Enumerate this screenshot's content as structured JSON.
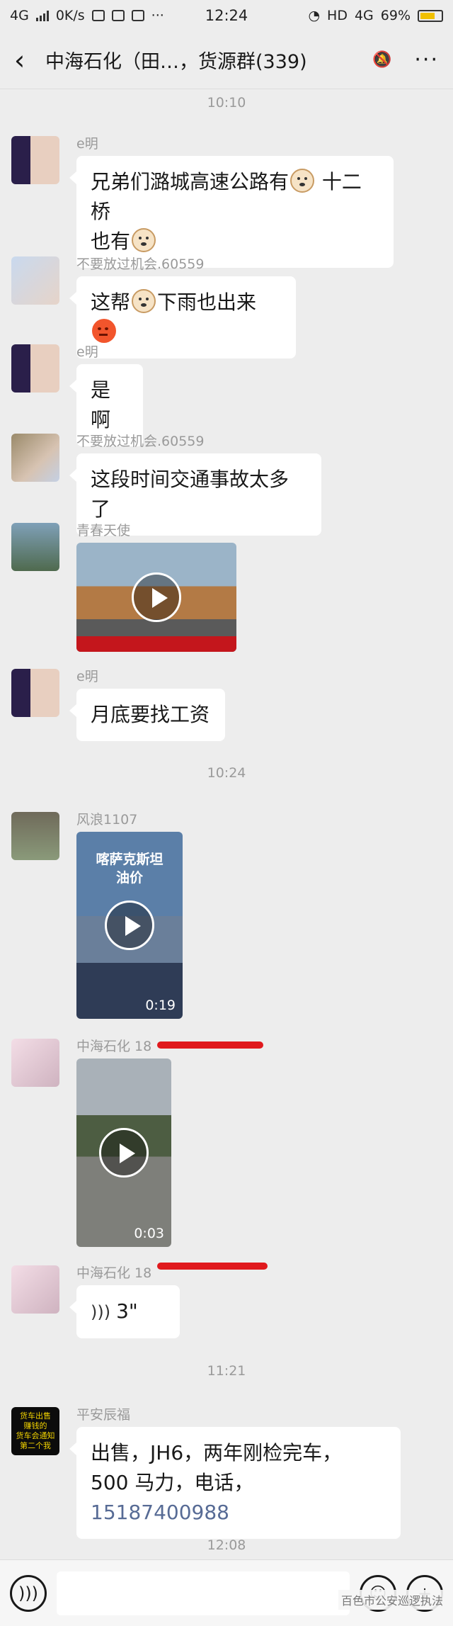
{
  "status_bar": {
    "network": "4G",
    "speed": "0K/s",
    "time": "12:24",
    "right_text": "HD",
    "network_right": "4G",
    "battery": "69%"
  },
  "header": {
    "back_icon": "chevron-left-icon",
    "title": "中海石化（田…，货源群(339)",
    "mute_icon": "bell-off-icon",
    "more_icon": "more-dots-icon"
  },
  "messages": {
    "time_1": "10:10",
    "m1_sender": "e明",
    "m1_text_a": "兄弟们潞城高速公路有",
    "m1_text_b": " 十二桥",
    "m1_text_c": "也有",
    "m2_sender": "不要放过机会.60559",
    "m2_text_a": "这帮",
    "m2_text_b": "下雨也出来",
    "m3_sender": "e明",
    "m3_text": "是啊",
    "m4_sender": "不要放过机会.60559",
    "m4_text": "这段时间交通事故太多了",
    "m5_sender": "青春天使",
    "m6_sender": "e明",
    "m6_text": "月底要找工资",
    "time_2": "10:24",
    "m7_sender": "风浪1107",
    "m7_video_caption": "喀萨克斯坦\n油价",
    "m7_duration": "0:19",
    "m8_sender": "中海石化 18",
    "m8_duration": "0:03",
    "m9_sender": "中海石化 18",
    "m9_voice_length": "3\"",
    "time_3": "11:21",
    "m10_sender": "平安辰福",
    "m10_avatar_text": "货车出售\n赚钱的\n货车会通知\n第二个我",
    "m10_text_a": "出售，JH6，两年刚检完车，",
    "m10_text_b": "500 马力，电话，",
    "m10_phone": "15187400988",
    "time_4": "12:08"
  },
  "input_bar": {
    "voice_icon": "voice-icon",
    "emoji_icon": "emoji-icon",
    "add_icon": "plus-icon"
  },
  "watermark": "百色市公安巡逻执法",
  "colors": {
    "background": "#ededed",
    "bubble": "#ffffff",
    "link": "#576b95",
    "red_mark": "#e0191d"
  }
}
